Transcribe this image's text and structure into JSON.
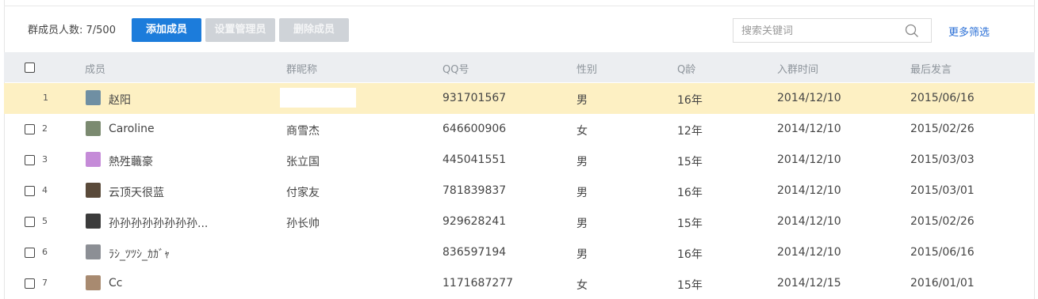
{
  "toolbar": {
    "member_count": "群成员人数: 7/500",
    "add_member": "添加成员",
    "set_admin": "设置管理员",
    "remove_member": "删除成员",
    "search_placeholder": "搜索关键词",
    "more_filters": "更多筛选"
  },
  "table": {
    "headers": {
      "member": "成员",
      "nickname": "群昵称",
      "qq": "QQ号",
      "gender": "性别",
      "qage": "Q龄",
      "join_time": "入群时间",
      "last_speak": "最后发言"
    },
    "rows": [
      {
        "index": "1",
        "name": "赵阳",
        "nickname": "",
        "qq": "931701567",
        "gender": "男",
        "qage": "16年",
        "join": "2014/12/10",
        "last": "2015/06/16",
        "avatar_color": "#6f8fa3",
        "highlight": true
      },
      {
        "index": "2",
        "name": "Caroline",
        "nickname": "商雪杰",
        "qq": "646600906",
        "gender": "女",
        "qage": "12年",
        "join": "2014/12/10",
        "last": "2015/02/26",
        "avatar_color": "#7b8a70"
      },
      {
        "index": "3",
        "name": "熱殅蘵豪",
        "nickname": "张立国",
        "qq": "445041551",
        "gender": "男",
        "qage": "15年",
        "join": "2014/12/10",
        "last": "2015/03/03",
        "avatar_color": "#c58bd8"
      },
      {
        "index": "4",
        "name": "云顶天很蓝",
        "nickname": "付家友",
        "qq": "781839837",
        "gender": "男",
        "qage": "16年",
        "join": "2014/12/10",
        "last": "2015/03/01",
        "avatar_color": "#5a4a3a"
      },
      {
        "index": "5",
        "name": "孙孙孙孙孙孙孙孙...",
        "nickname": "孙长帅",
        "qq": "929628241",
        "gender": "男",
        "qage": "15年",
        "join": "2014/12/10",
        "last": "2015/02/26",
        "avatar_color": "#3b3b3b"
      },
      {
        "index": "6",
        "name": "ﾗｼ_ﾂﾂｼ_ｶｶﾞｬ",
        "nickname": "",
        "qq": "836597194",
        "gender": "男",
        "qage": "16年",
        "join": "2014/12/10",
        "last": "2015/06/16",
        "avatar_color": "#8c8f95"
      },
      {
        "index": "7",
        "name": "Cc",
        "nickname": "",
        "qq": "1171687277",
        "gender": "女",
        "qage": "15年",
        "join": "2014/12/15",
        "last": "2016/01/01",
        "avatar_color": "#a88a70"
      }
    ]
  }
}
